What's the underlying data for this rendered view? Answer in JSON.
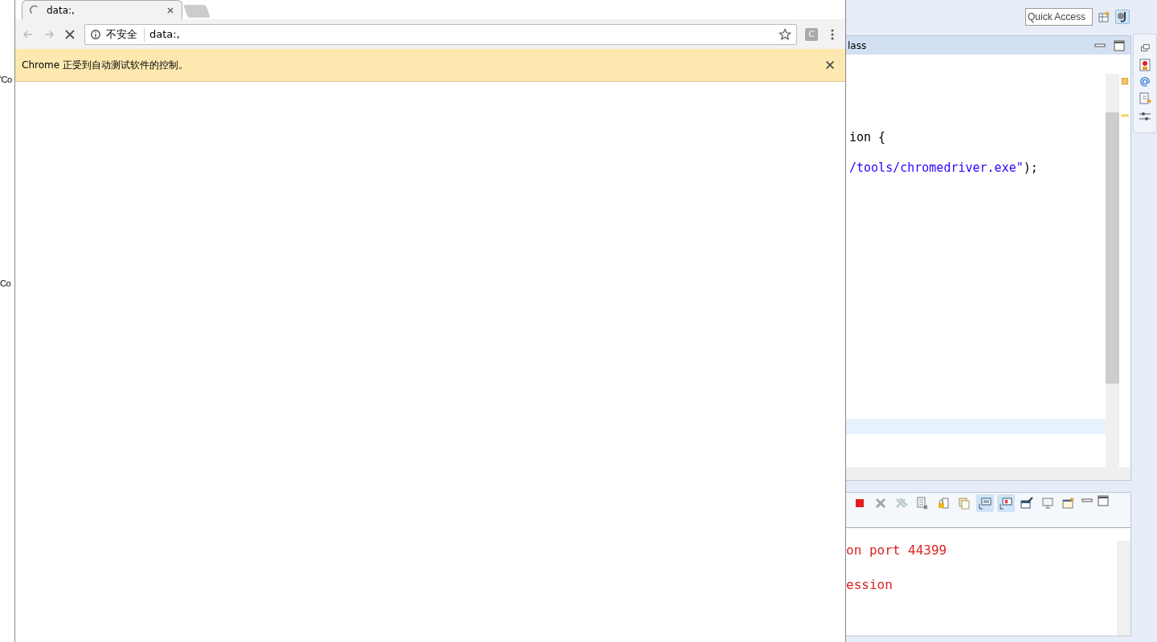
{
  "eclipse": {
    "left_fragments": [
      "'Co",
      "Co"
    ],
    "quick_access": {
      "placeholder": "Quick Access"
    },
    "editor": {
      "tab_title": "lass",
      "lines": [
        {
          "segments": [
            {
              "text": "ion {",
              "kind": "plain"
            }
          ]
        },
        {
          "segments": [
            {
              "text": "/tools/chromedriver.exe\"",
              "kind": "string"
            },
            {
              "text": ");",
              "kind": "plain"
            }
          ]
        }
      ]
    },
    "console": {
      "toolbar": [
        {
          "kind": "terminate",
          "selected": false
        },
        {
          "kind": "remove",
          "selected": false
        },
        {
          "kind": "remove-all",
          "selected": false
        },
        {
          "kind": "clear",
          "selected": false
        },
        {
          "kind": "lock",
          "selected": false
        },
        {
          "kind": "wrap",
          "selected": false
        },
        {
          "kind": "stdout",
          "selected": true
        },
        {
          "kind": "stderr",
          "selected": true
        },
        {
          "kind": "pin",
          "selected": false
        },
        {
          "kind": "display",
          "selected": false
        },
        {
          "kind": "open",
          "selected": false
        }
      ],
      "lines": [
        "on port 44399",
        "ession"
      ]
    }
  },
  "browser": {
    "tabs": [
      {
        "title": "data:,",
        "selected": true
      }
    ],
    "omnibox": {
      "security": "不安全",
      "url": "data:,"
    },
    "extension": "C",
    "infobar": "Chrome 正受到自动测试软件的控制。"
  }
}
